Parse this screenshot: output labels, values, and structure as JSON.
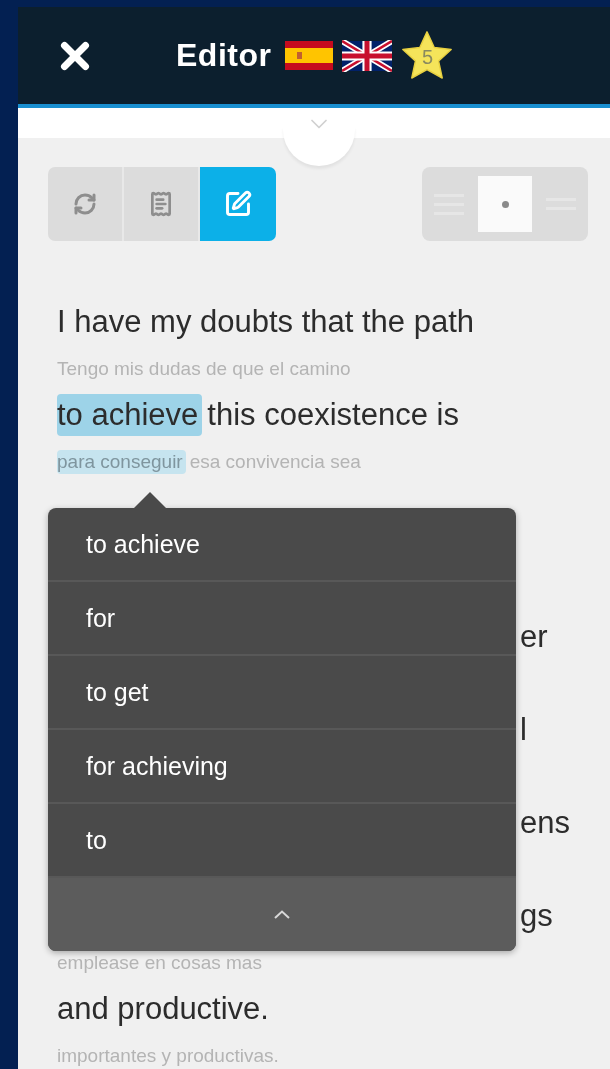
{
  "header": {
    "title": "Editor",
    "star_count": "5"
  },
  "modes": [
    {
      "kind": "refresh",
      "selected": false
    },
    {
      "kind": "document",
      "selected": false
    },
    {
      "kind": "edit",
      "selected": true
    }
  ],
  "layout_toggle": [
    {
      "kind": "lines",
      "selected": false
    },
    {
      "kind": "dot",
      "selected": true
    },
    {
      "kind": "lines",
      "selected": false
    }
  ],
  "lines": [
    {
      "kind": "pair",
      "english": [
        {
          "text": "I have my doubts that the path",
          "highlighted": false
        }
      ],
      "spanish": [
        {
          "text": "Tengo mis dudas de que el camino",
          "highlighted": false
        }
      ]
    },
    {
      "kind": "pair",
      "english": [
        {
          "text": "to achieve",
          "highlighted": true
        },
        {
          "text": "this coexistence is",
          "highlighted": false
        }
      ],
      "spanish": [
        {
          "text": "para conseguir",
          "highlighted": true
        },
        {
          "text": "esa convivencia sea",
          "highlighted": false
        }
      ]
    },
    {
      "kind": "hidden"
    },
    {
      "kind": "fragment",
      "english": [
        {
          "text": "er",
          "highlighted": false
        }
      ]
    },
    {
      "kind": "fragment",
      "english": [
        {
          "text": "l",
          "highlighted": false
        }
      ]
    },
    {
      "kind": "fragment",
      "english": [
        {
          "text": "ens",
          "highlighted": false
        }
      ]
    },
    {
      "kind": "fragment",
      "english": [
        {
          "text": "gs",
          "highlighted": false
        }
      ],
      "spanish": [
        {
          "text": "emplease en cosas mas",
          "highlighted": false
        }
      ]
    },
    {
      "kind": "pair",
      "english": [
        {
          "text": "and productive.",
          "highlighted": false
        }
      ],
      "spanish": [
        {
          "text": "importantes y productivas.",
          "highlighted": false
        }
      ]
    }
  ],
  "popup": {
    "options": [
      {
        "label": "to achieve"
      },
      {
        "label": "for"
      },
      {
        "label": "to get"
      },
      {
        "label": "for achieving"
      },
      {
        "label": "to"
      }
    ],
    "collapse": true
  }
}
